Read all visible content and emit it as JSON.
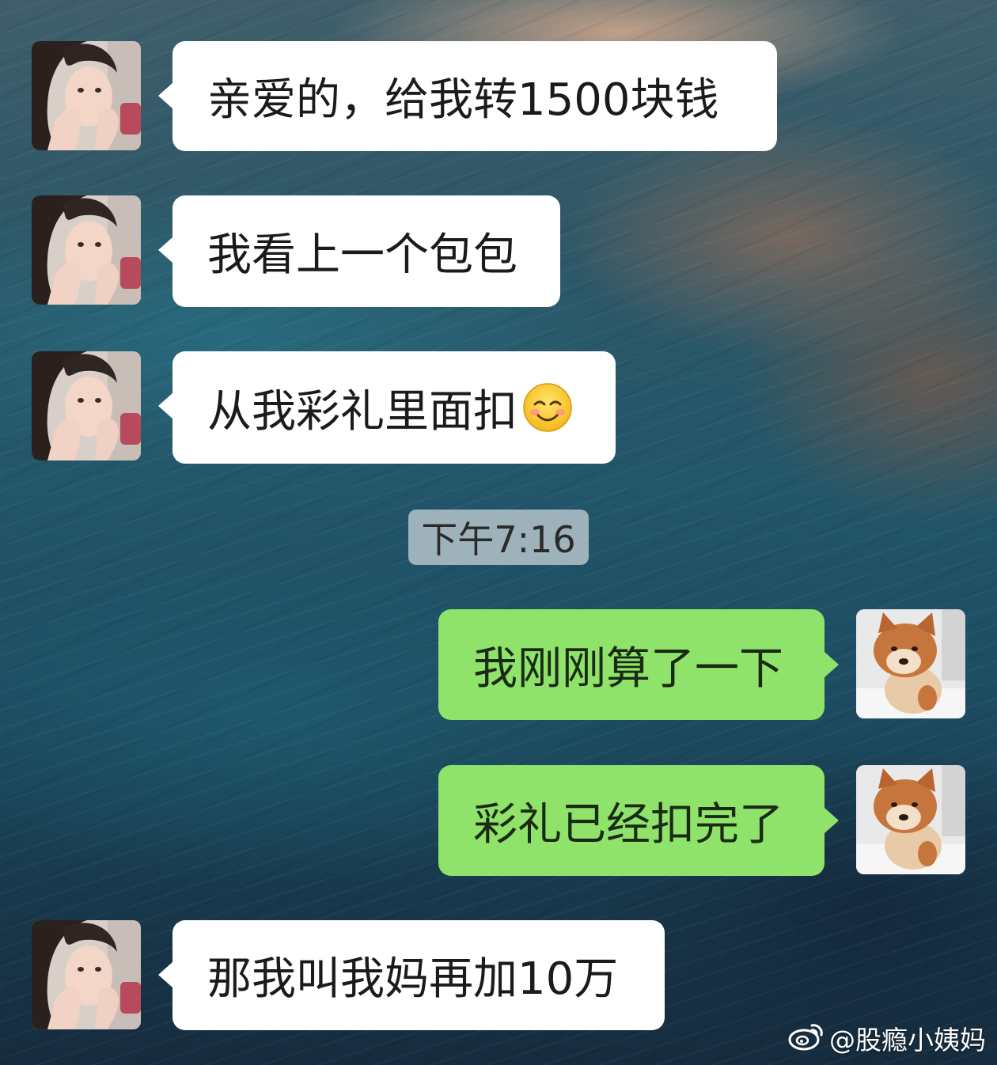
{
  "messages": [
    {
      "side": "incoming",
      "text": "亲爱的，给我转1500块钱"
    },
    {
      "side": "incoming",
      "text": "我看上一个包包"
    },
    {
      "side": "incoming",
      "text": "从我彩礼里面扣",
      "emoji": "smiling-face-emoji"
    },
    {
      "side": "outgoing",
      "text": "我刚刚算了一下"
    },
    {
      "side": "outgoing",
      "text": "彩礼已经扣完了"
    },
    {
      "side": "incoming",
      "text": "那我叫我妈再加10万"
    }
  ],
  "timestamp": "下午7:16",
  "watermark": {
    "icon": "weibo-logo-icon",
    "text": "@股瘾小姨妈"
  },
  "avatars": {
    "incoming": "woman-photo-avatar",
    "outgoing": "shiba-puppy-avatar"
  },
  "colors": {
    "incoming_bubble": "#ffffff",
    "outgoing_bubble": "#8fe36a"
  }
}
